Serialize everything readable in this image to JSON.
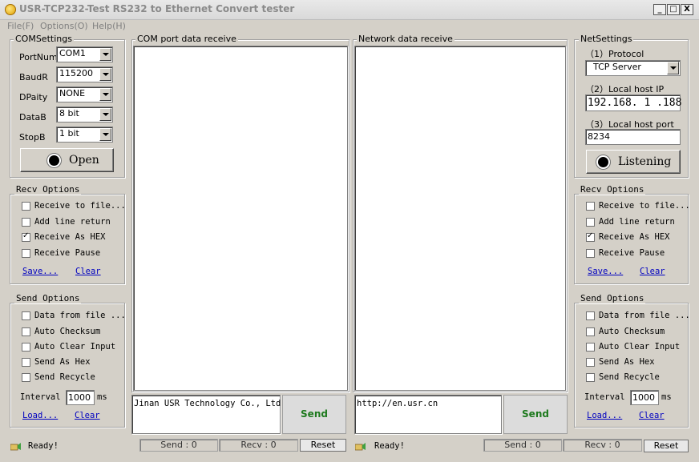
{
  "window": {
    "title": "USR-TCP232-Test  RS232 to Ethernet Convert tester",
    "minimize": "_",
    "maximize": "□",
    "close": "X"
  },
  "menu": [
    "File(F)",
    "Options(O)",
    "Help(H)"
  ],
  "com_settings": {
    "title": "COMSettings",
    "fields": [
      {
        "label": "PortNum",
        "value": "COM1"
      },
      {
        "label": "BaudR",
        "value": "115200"
      },
      {
        "label": "DPaity",
        "value": "NONE"
      },
      {
        "label": "DataB",
        "value": "8 bit"
      },
      {
        "label": "StopB",
        "value": "1 bit"
      }
    ],
    "open_label": "Open"
  },
  "net_settings": {
    "title": "NetSettings",
    "protocol_label": "（1）Protocol",
    "protocol_value": "TCP Server",
    "ip_label": "（2）Local host IP",
    "ip_value": "192.168. 1 .188",
    "port_label": "（3）Local host port",
    "port_value": "8234",
    "listen_label": "Listening"
  },
  "left_recv": {
    "title": "Recv Options",
    "options": [
      {
        "label": "Receive to file...",
        "checked": false
      },
      {
        "label": "Add line return",
        "checked": false
      },
      {
        "label": "Receive As HEX",
        "checked": true
      },
      {
        "label": "Receive Pause",
        "checked": false
      }
    ],
    "save": "Save...",
    "clear": "Clear"
  },
  "right_recv": {
    "title": "Recv Options",
    "options": [
      {
        "label": "Receive to file...",
        "checked": false
      },
      {
        "label": "Add line return",
        "checked": false
      },
      {
        "label": "Receive As HEX",
        "checked": true
      },
      {
        "label": "Receive Pause",
        "checked": false
      }
    ],
    "save": "Save...",
    "clear": "Clear"
  },
  "left_send": {
    "title": "Send Options",
    "options": [
      {
        "label": "Data from file ...",
        "checked": false
      },
      {
        "label": "Auto Checksum",
        "checked": false
      },
      {
        "label": "Auto Clear Input",
        "checked": false
      },
      {
        "label": "Send As Hex",
        "checked": false
      },
      {
        "label": "Send Recycle",
        "checked": false
      }
    ],
    "interval_label": "Interval",
    "interval_value": "1000",
    "interval_unit": "ms",
    "load": "Load...",
    "clear": "Clear"
  },
  "right_send": {
    "title": "Send Options",
    "options": [
      {
        "label": "Data from file ...",
        "checked": false
      },
      {
        "label": "Auto Checksum",
        "checked": false
      },
      {
        "label": "Auto Clear Input",
        "checked": false
      },
      {
        "label": "Send As Hex",
        "checked": false
      },
      {
        "label": "Send Recycle",
        "checked": false
      }
    ],
    "interval_label": "Interval",
    "interval_value": "1000",
    "interval_unit": "ms",
    "load": "Load...",
    "clear": "Clear"
  },
  "com_panel": {
    "title": "COM port data receive",
    "send_text": "Jinan USR Technology Co., Ltd.",
    "send_label": "Send"
  },
  "net_panel": {
    "title": "Network data receive",
    "send_text": "http://en.usr.cn",
    "send_label": "Send"
  },
  "status_left": {
    "ready": "Ready!",
    "send": "Send : 0",
    "recv": "Recv : 0",
    "reset": "Reset"
  },
  "status_right": {
    "ready": "Ready!",
    "send": "Send : 0",
    "recv": "Recv : 0",
    "reset": "Reset"
  }
}
